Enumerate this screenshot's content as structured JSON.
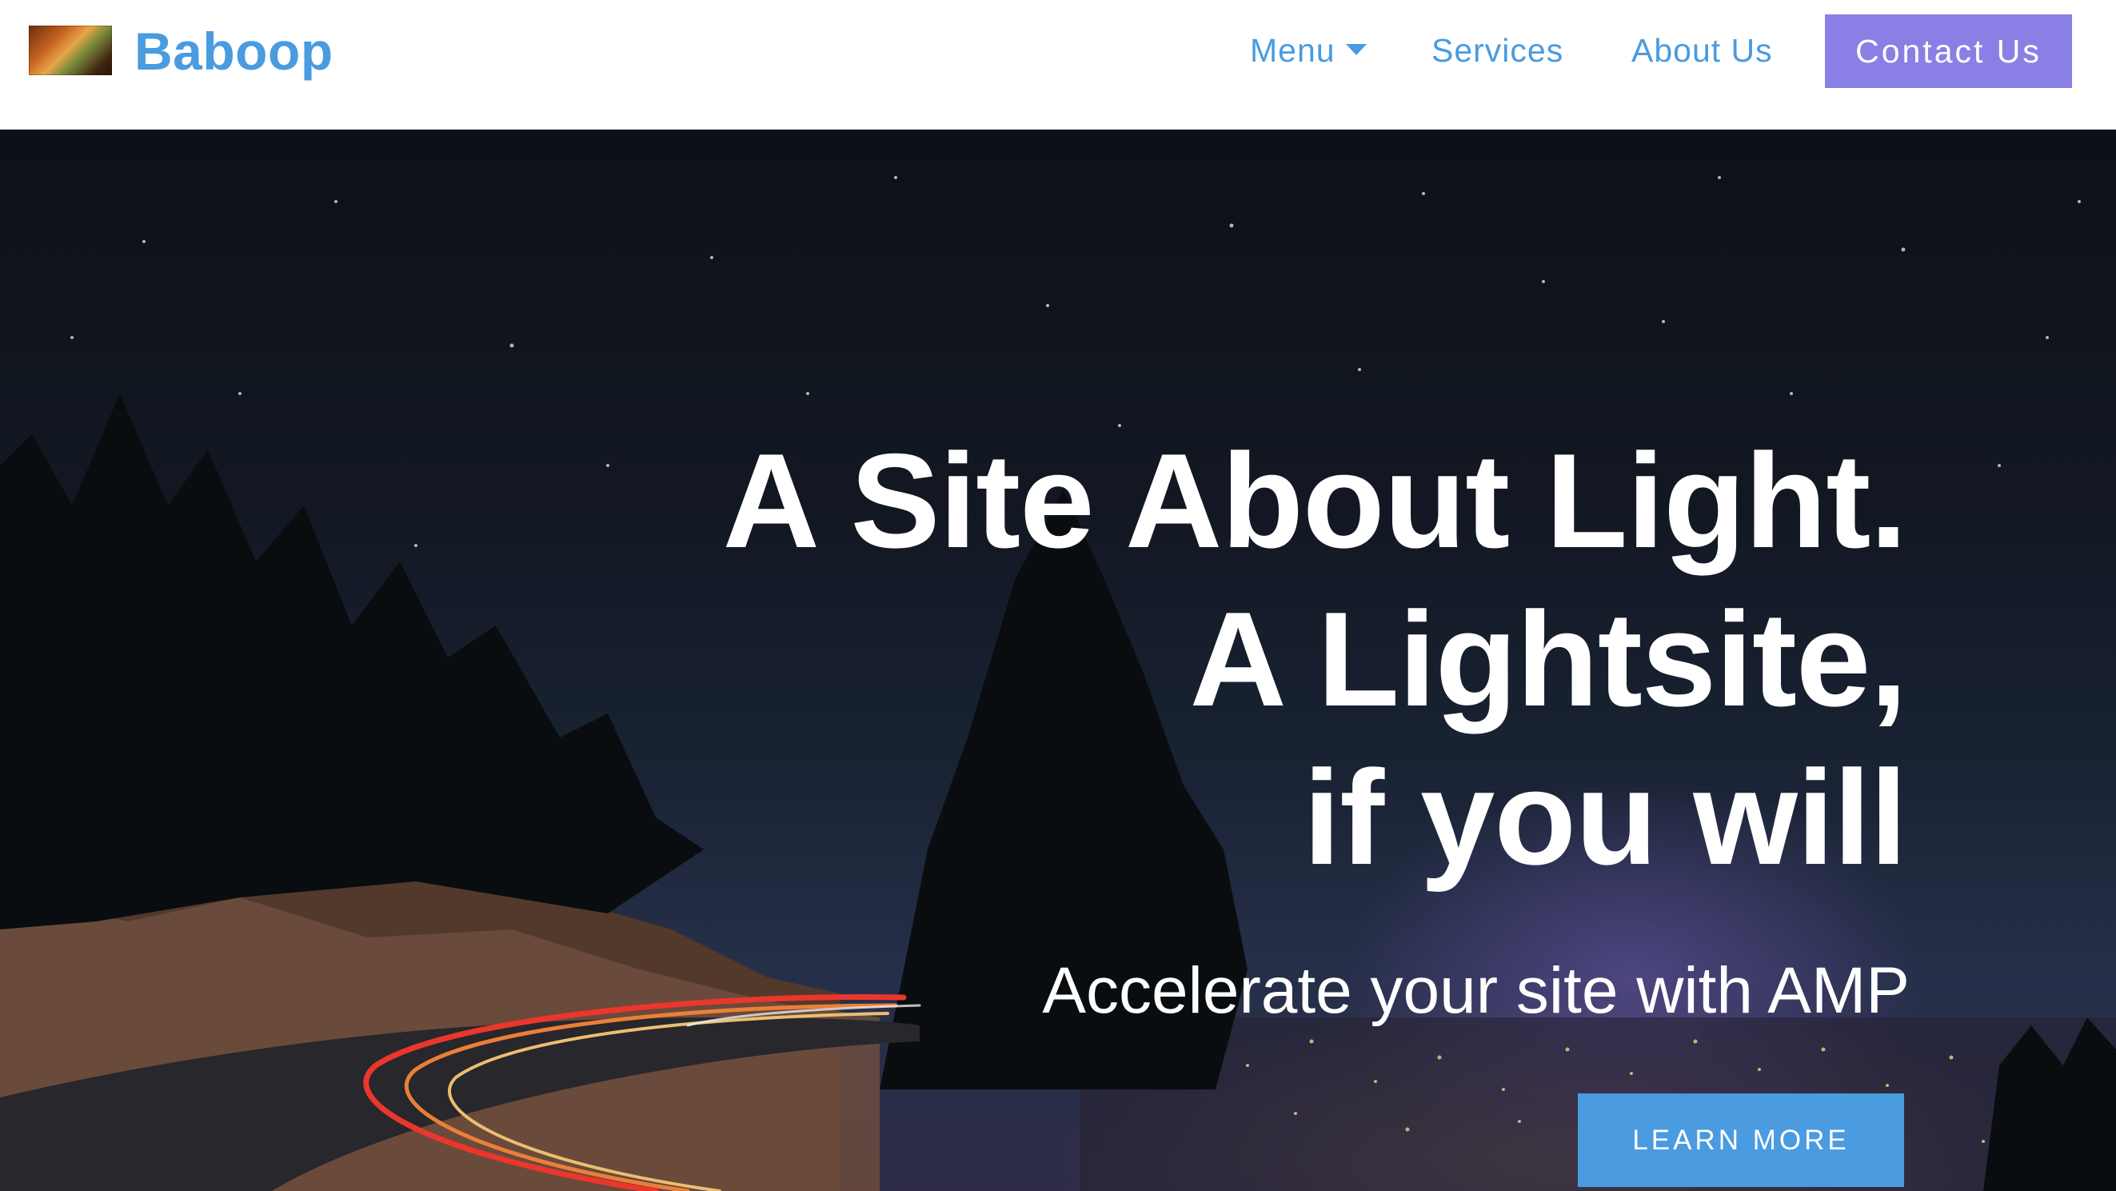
{
  "brand": {
    "logo_icon": "landscape-thumbnail-icon",
    "name": "Baboop"
  },
  "nav": {
    "menu_label": "Menu",
    "menu_caret_icon": "caret-down-icon",
    "services_label": "Services",
    "about_label": "About Us",
    "contact_label": "Contact Us"
  },
  "hero": {
    "title_lines": [
      "A Site About Light.",
      "A Lightsite,",
      "if you will"
    ],
    "subtitle": "Accelerate your site with AMP",
    "cta_label": "LEARN MORE"
  },
  "colors": {
    "brand_blue": "#4a9be0",
    "contact_purple": "#8a7fe5",
    "hero_text": "#ffffff"
  }
}
